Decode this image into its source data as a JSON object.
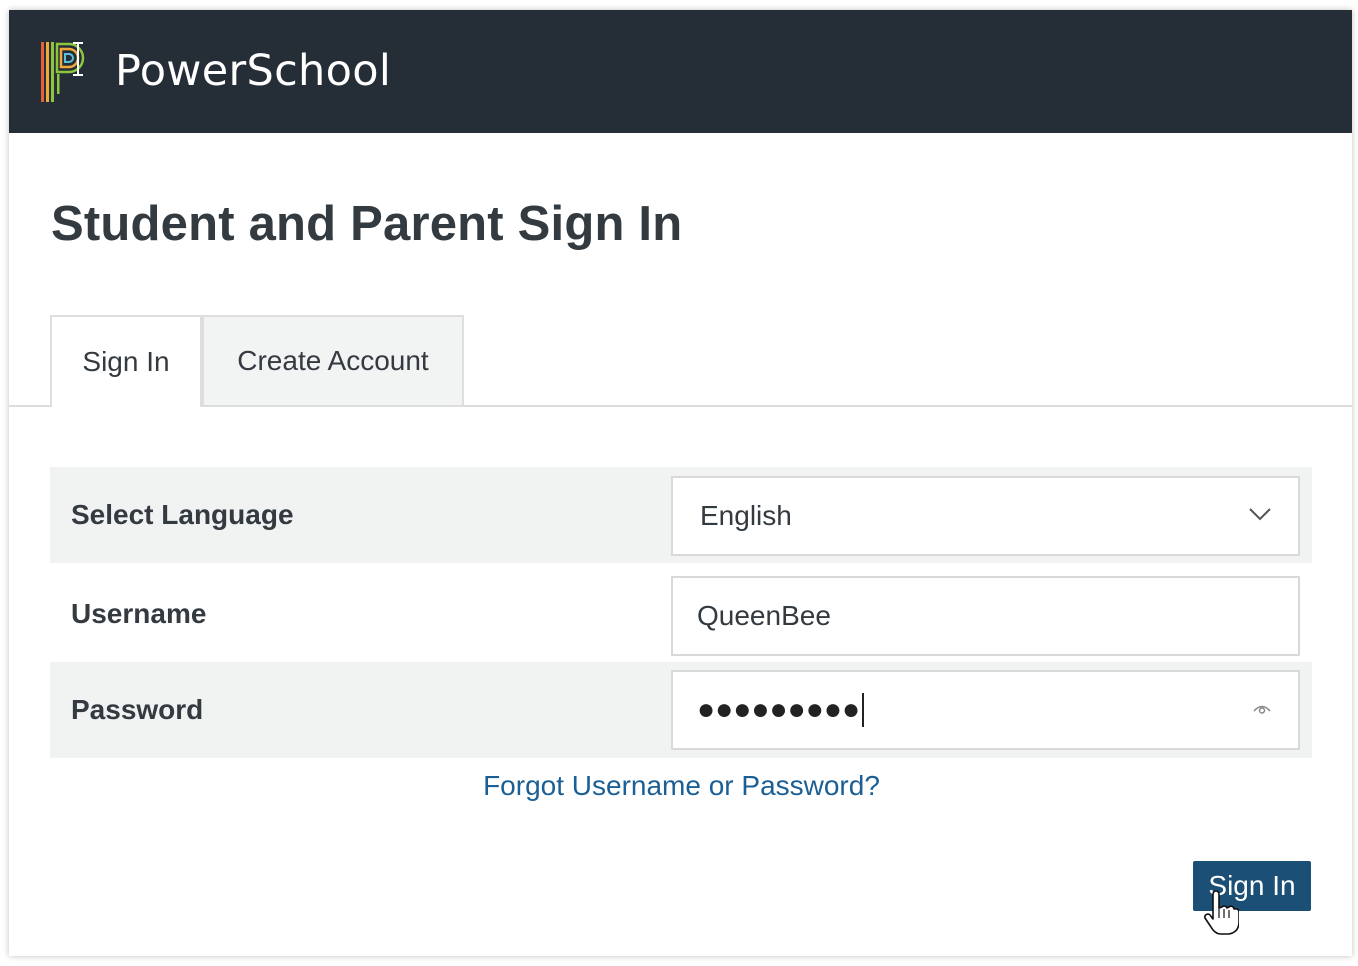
{
  "header": {
    "brand_name": "PowerSchool",
    "logo_icon": "powerschool-logo-icon",
    "background_color": "#252d36"
  },
  "page": {
    "title": "Student and Parent Sign In"
  },
  "tabs": [
    {
      "label": "Sign In",
      "active": true
    },
    {
      "label": "Create Account",
      "active": false
    }
  ],
  "form": {
    "language": {
      "label": "Select Language",
      "selected": "English",
      "icon": "chevron-down-icon"
    },
    "username": {
      "label": "Username",
      "value": "QueenBee"
    },
    "password": {
      "label": "Password",
      "masked_value": "●●●●●●●●●",
      "icon": "eye-icon"
    },
    "forgot_link": "Forgot Username or Password?",
    "submit_label": "Sign In"
  },
  "colors": {
    "link": "#1c5f94",
    "button": "#1b4f75"
  }
}
